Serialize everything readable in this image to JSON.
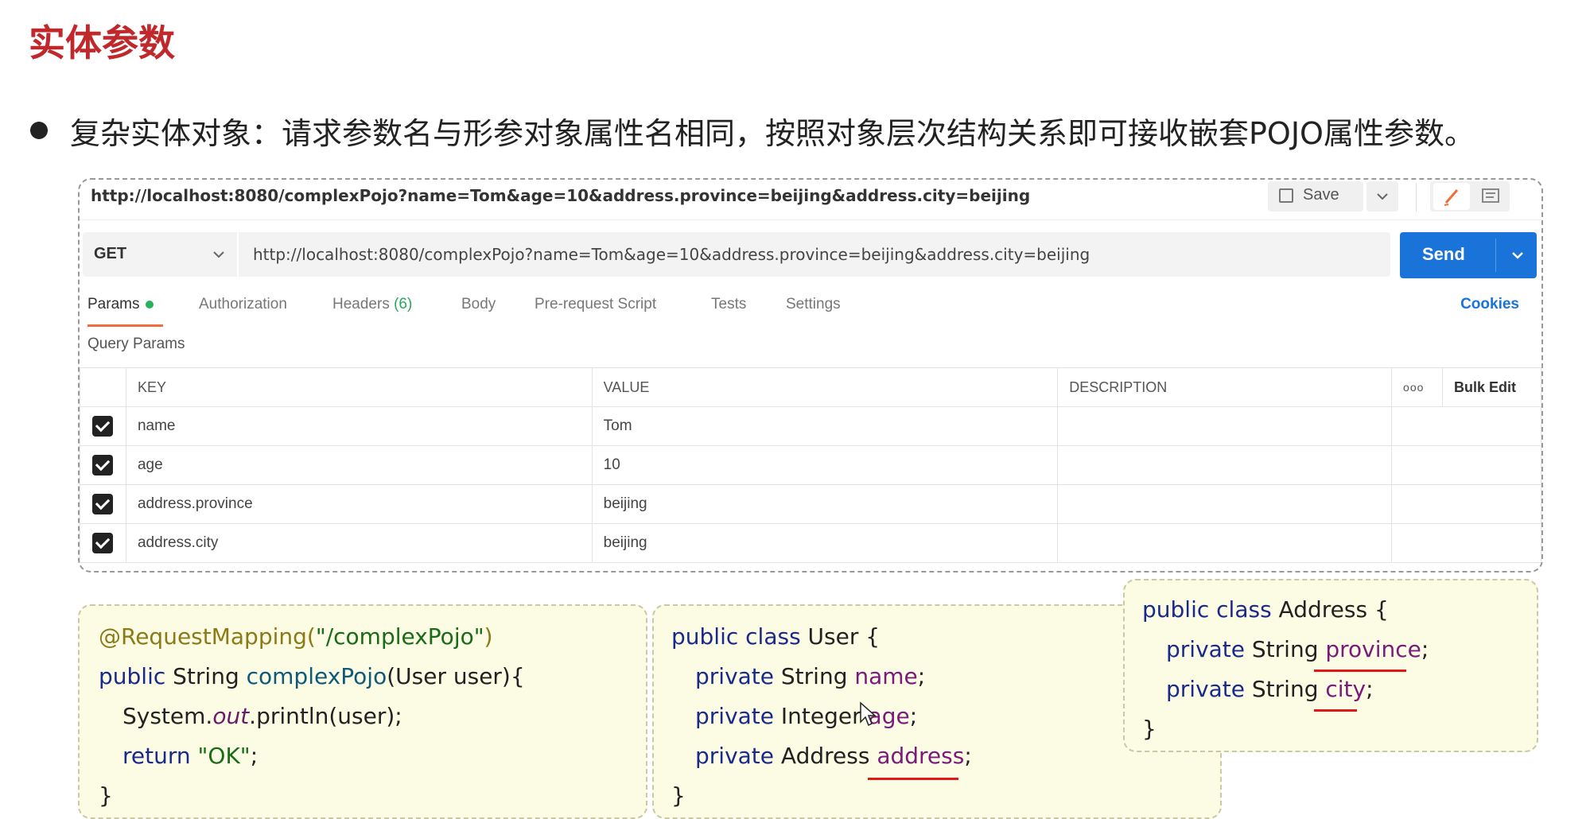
{
  "slide": {
    "title": "实体参数",
    "bullet": "复杂实体对象：请求参数名与形参对象属性名相同，按照对象层次结构关系即可接收嵌套POJO属性参数。"
  },
  "postman": {
    "tab_url": "http://localhost:8080/complexPojo?name=Tom&age=10&address.province=beijing&address.city=beijing",
    "save_label": "Save",
    "method": "GET",
    "url": "http://localhost:8080/complexPojo?name=Tom&age=10&address.province=beijing&address.city=beijing",
    "send_label": "Send",
    "tabs": {
      "params": "Params",
      "authorization": "Authorization",
      "headers": "Headers",
      "headers_count": "(6)",
      "body": "Body",
      "prerequest": "Pre-request Script",
      "tests": "Tests",
      "settings": "Settings"
    },
    "cookies": "Cookies",
    "query_params_title": "Query Params",
    "table": {
      "headers": {
        "key": "KEY",
        "value": "VALUE",
        "description": "DESCRIPTION",
        "more": "ooo",
        "bulk": "Bulk Edit"
      },
      "rows": [
        {
          "key": "name",
          "value": "Tom",
          "checked": true
        },
        {
          "key": "age",
          "value": "10",
          "checked": true
        },
        {
          "key": "address.province",
          "value": "beijing",
          "checked": true
        },
        {
          "key": "address.city",
          "value": "beijing",
          "checked": true
        }
      ]
    }
  },
  "code_controller": {
    "l1_annotation": "@RequestMapping(",
    "l1_string": "\"/complexPojo\"",
    "l1_close": ")",
    "l2_kw": "public",
    "l2_type": " String ",
    "l2_fn": "complexPojo",
    "l2_rest": "(User user){",
    "l3_pre": "System.",
    "l3_italic": "out",
    "l3_post": ".println(user);",
    "l4_kw": "return",
    "l4_str": " \"OK\"",
    "l4_end": ";",
    "l5": "}"
  },
  "code_user": {
    "l1_kw": "public class",
    "l1_rest": " User {",
    "l2_kw": "private",
    "l2_type": " String ",
    "l2_fld": "name",
    "l2_end": ";",
    "l3_kw": "private",
    "l3_type": " Integer ",
    "l3_fld": "age",
    "l3_end": ";",
    "l4_kw": "private",
    "l4_type": " Address ",
    "l4_fld": "address",
    "l4_end": ";",
    "l5": "}"
  },
  "code_address": {
    "l1_kw": "public class",
    "l1_rest": " Address {",
    "l2_kw": "private",
    "l2_type": " String ",
    "l2_fld": "province",
    "l2_end": ";",
    "l3_kw": "private",
    "l3_type": " String ",
    "l3_fld": "city",
    "l3_end": ";",
    "l4": "}"
  },
  "colors": {
    "title_red": "#c0282b",
    "send_blue": "#1a73d9",
    "tab_orange": "#f26b3a",
    "status_green": "#27b35e",
    "underline_red": "#e01818"
  },
  "icons": [
    "save-icon",
    "chevron-down-icon",
    "pencil-icon",
    "comment-icon",
    "more-dots-icon",
    "checkbox-checked-icon",
    "mouse-cursor-icon"
  ]
}
